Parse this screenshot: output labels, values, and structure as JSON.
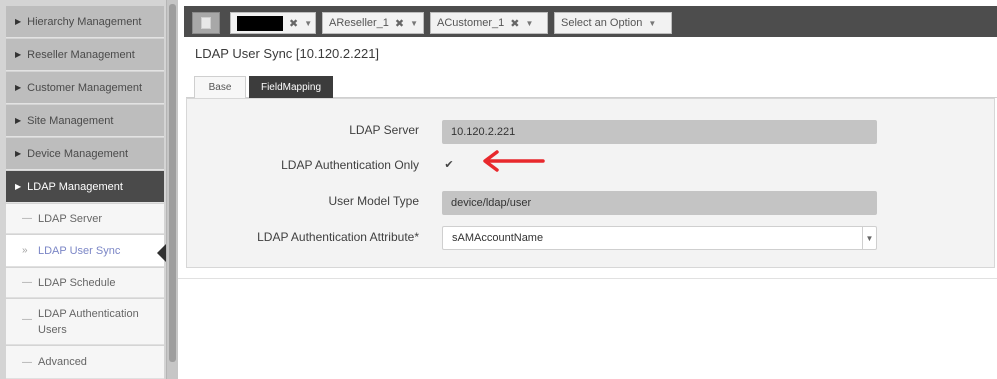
{
  "sidebar": {
    "menu": [
      {
        "label": "Hierarchy Management"
      },
      {
        "label": "Reseller Management"
      },
      {
        "label": "Customer Management"
      },
      {
        "label": "Site Management"
      },
      {
        "label": "Device Management"
      },
      {
        "label": "LDAP Management"
      }
    ],
    "submenu": [
      {
        "label": "LDAP Server"
      },
      {
        "label": "LDAP User Sync"
      },
      {
        "label": "LDAP Schedule"
      },
      {
        "label": "LDAP Authentication Users"
      },
      {
        "label": "Advanced"
      }
    ]
  },
  "topbar": {
    "chips": [
      {
        "label": "",
        "redacted": true
      },
      {
        "label": "AReseller_1"
      },
      {
        "label": "ACustomer_1"
      },
      {
        "label": "Select an Option"
      }
    ]
  },
  "page": {
    "title": "LDAP User Sync [10.120.2.221]",
    "tabs": [
      {
        "label": "Base"
      },
      {
        "label": "FieldMapping"
      }
    ]
  },
  "form": {
    "ldap_server_label": "LDAP Server",
    "ldap_server_value": "10.120.2.221",
    "auth_only_label": "LDAP Authentication Only",
    "auth_only_checked": true,
    "user_model_label": "User Model Type",
    "user_model_value": "device/ldap/user",
    "auth_attr_label": "LDAP Authentication Attribute*",
    "auth_attr_value": "sAMAccountName"
  },
  "annotation": {
    "arrow_color": "#e8282c"
  }
}
